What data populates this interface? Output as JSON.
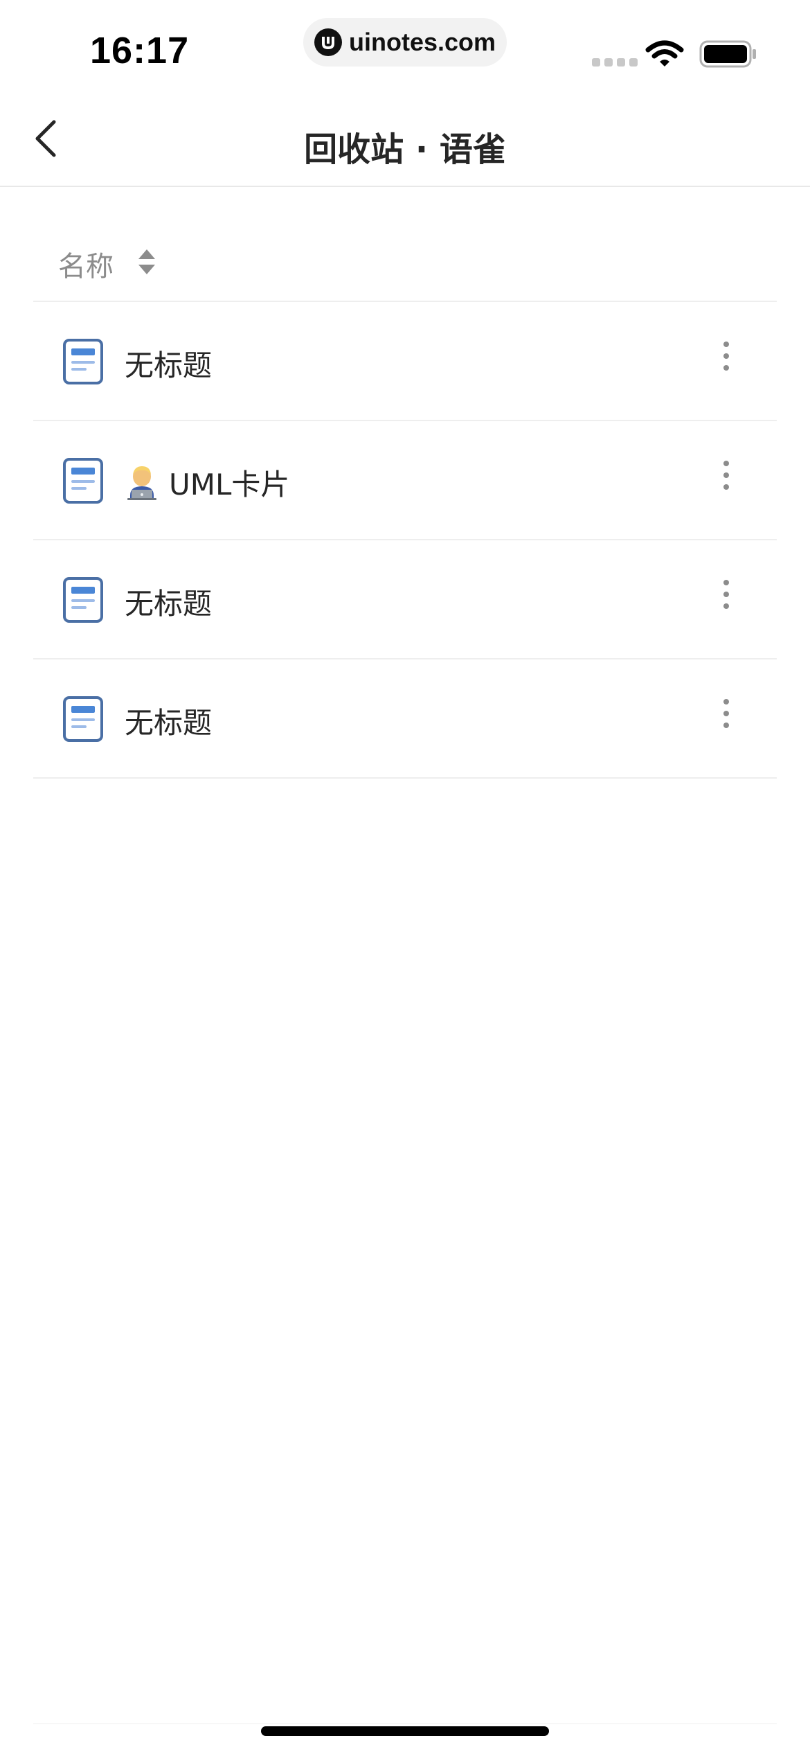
{
  "status_bar": {
    "time": "16:17",
    "url": "uinotes.com",
    "icons": [
      "cellular-signal-icon",
      "wifi-icon",
      "battery-icon"
    ]
  },
  "nav": {
    "back_icon": "chevron-left-icon",
    "title": "回收站 · 语雀"
  },
  "sort": {
    "label": "名称",
    "icon": "sort-toggle-icon"
  },
  "items": [
    {
      "title": "无标题",
      "emoji": "",
      "icon": "document-icon"
    },
    {
      "title": "UML卡片",
      "emoji": "technologist-emoji",
      "icon": "document-icon"
    },
    {
      "title": "无标题",
      "emoji": "",
      "icon": "document-icon"
    },
    {
      "title": "无标题",
      "emoji": "",
      "icon": "document-icon"
    }
  ],
  "colors": {
    "doc_icon_border": "#4a6fa5",
    "doc_icon_bar": "#4a86d6",
    "doc_icon_lines": "#9dbbe8",
    "divider": "#eeeeee",
    "secondary_text": "#8c8c8c",
    "primary_text": "#262626"
  }
}
